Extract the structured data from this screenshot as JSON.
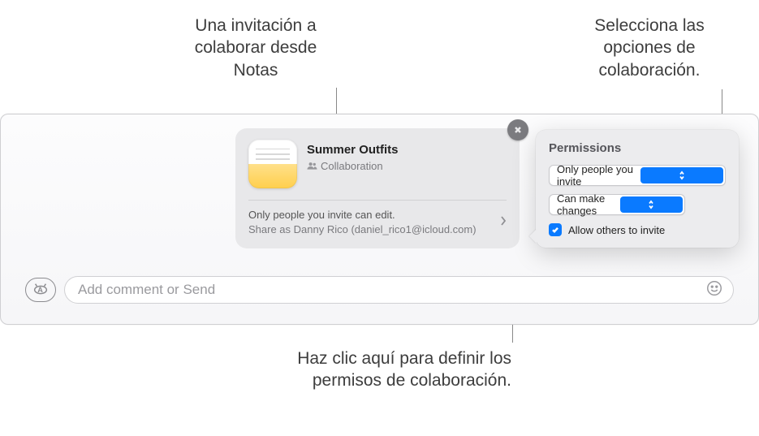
{
  "callouts": {
    "invite": "Una invitación a colaborar desde Notas",
    "options": "Selecciona las opciones de colaboración.",
    "permissions_hint": "Haz clic aquí para definir los permisos de colaboración."
  },
  "compose": {
    "placeholder": "Add comment or Send"
  },
  "card": {
    "title": "Summer Outfits",
    "subtitle": "Collaboration",
    "perm_text": "Only people you invite can edit.",
    "share_as": "Share as Danny Rico (daniel_rico1@icloud.com)"
  },
  "popover": {
    "title": "Permissions",
    "who": "Only people you invite",
    "can": "Can make changes",
    "allow_label": "Allow others to invite",
    "allow_checked": true
  }
}
